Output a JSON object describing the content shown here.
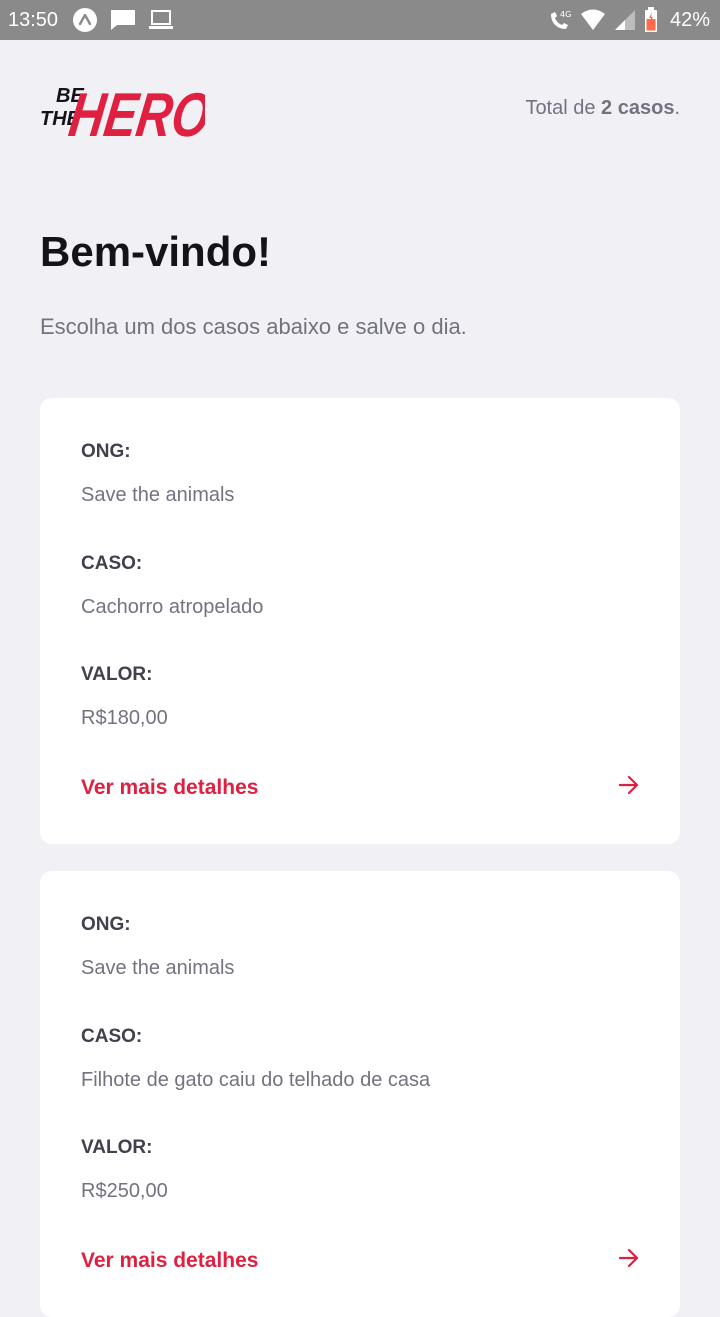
{
  "status_bar": {
    "time": "13:50",
    "battery": "42%",
    "left_icons": [
      "expo-icon",
      "message-icon",
      "laptop-icon"
    ],
    "right_icons": [
      "wifi-call-4g-icon",
      "wifi-icon",
      "signal-icon",
      "battery-icon"
    ]
  },
  "header": {
    "logo_be": "BE",
    "logo_the": "THE",
    "logo_hero": "HERO",
    "total_prefix": "Total de ",
    "total_count": "2 casos",
    "total_suffix": "."
  },
  "page": {
    "title": "Bem-vindo!",
    "subtitle": "Escolha um dos casos abaixo e salve o dia."
  },
  "incidents": [
    {
      "ong_label": "ONG:",
      "ong_value": "Save the animals",
      "caso_label": "CASO:",
      "caso_value": "Cachorro atropelado",
      "valor_label": "VALOR:",
      "valor_value": "R$180,00",
      "details_label": "Ver mais detalhes"
    },
    {
      "ong_label": "ONG:",
      "ong_value": "Save the animals",
      "caso_label": "CASO:",
      "caso_value": "Filhote de gato caiu do telhado de casa",
      "valor_label": "VALOR:",
      "valor_value": "R$250,00",
      "details_label": "Ver mais detalhes"
    }
  ],
  "colors": {
    "accent": "#e02041",
    "background": "#f0f0f5",
    "title": "#13131a",
    "label": "#41414d",
    "muted": "#737380"
  }
}
